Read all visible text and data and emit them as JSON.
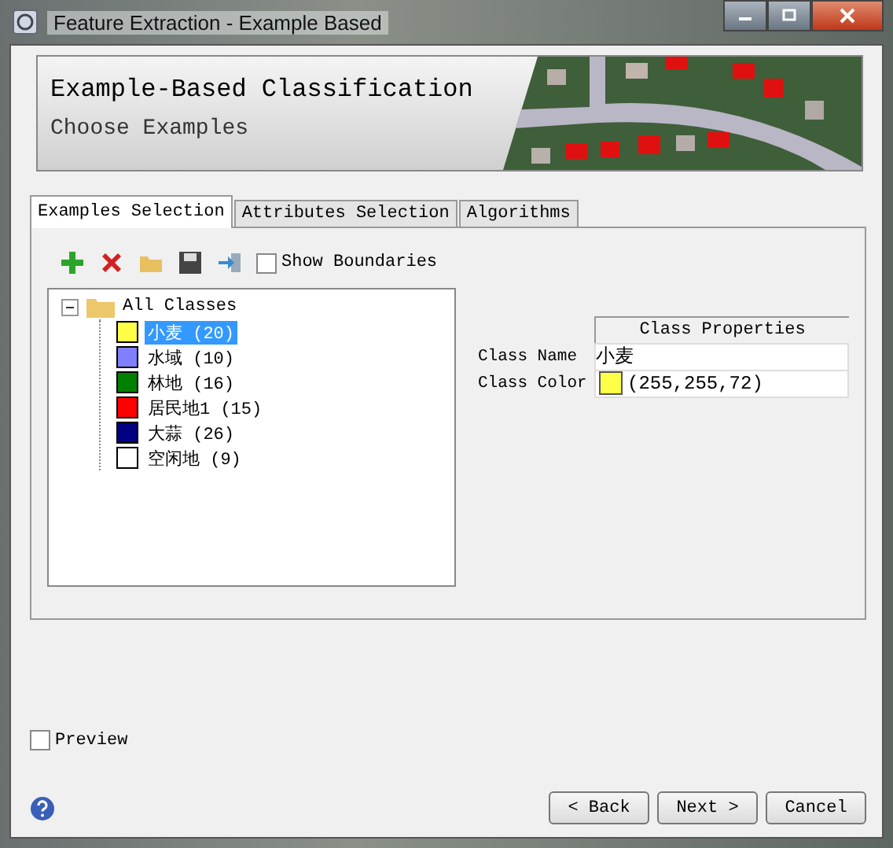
{
  "window": {
    "title": "Feature Extraction - Example Based"
  },
  "header": {
    "title": "Example-Based Classification",
    "subtitle": "Choose Examples"
  },
  "tabs": [
    {
      "label": "Examples Selection",
      "selected": true
    },
    {
      "label": "Attributes Selection",
      "selected": false
    },
    {
      "label": "Algorithms",
      "selected": false
    }
  ],
  "show_boundaries": {
    "label": "Show Boundaries",
    "checked": false
  },
  "tree": {
    "label": "All Classes",
    "expanded": true,
    "children": [
      {
        "label": "小麦 (20)",
        "color": "#ffff48",
        "selected": true
      },
      {
        "label": "水域 (10)",
        "color": "#8080ff",
        "selected": false
      },
      {
        "label": "林地 (16)",
        "color": "#008000",
        "selected": false
      },
      {
        "label": "居民地1 (15)",
        "color": "#ff0000",
        "selected": false
      },
      {
        "label": "大蒜 (26)",
        "color": "#000080",
        "selected": false
      },
      {
        "label": "空闲地 (9)",
        "color": "#ffffff",
        "selected": false
      }
    ]
  },
  "properties": {
    "header": "Class Properties",
    "rows": [
      {
        "kind": "text",
        "name": "Class Name",
        "value": "小麦"
      },
      {
        "kind": "color",
        "name": "Class Color",
        "value": "(255,255,72)",
        "color": "#ffff48"
      }
    ]
  },
  "preview": {
    "label": "Preview",
    "checked": false
  },
  "buttons": [
    "< Back",
    "Next >",
    "Cancel"
  ]
}
